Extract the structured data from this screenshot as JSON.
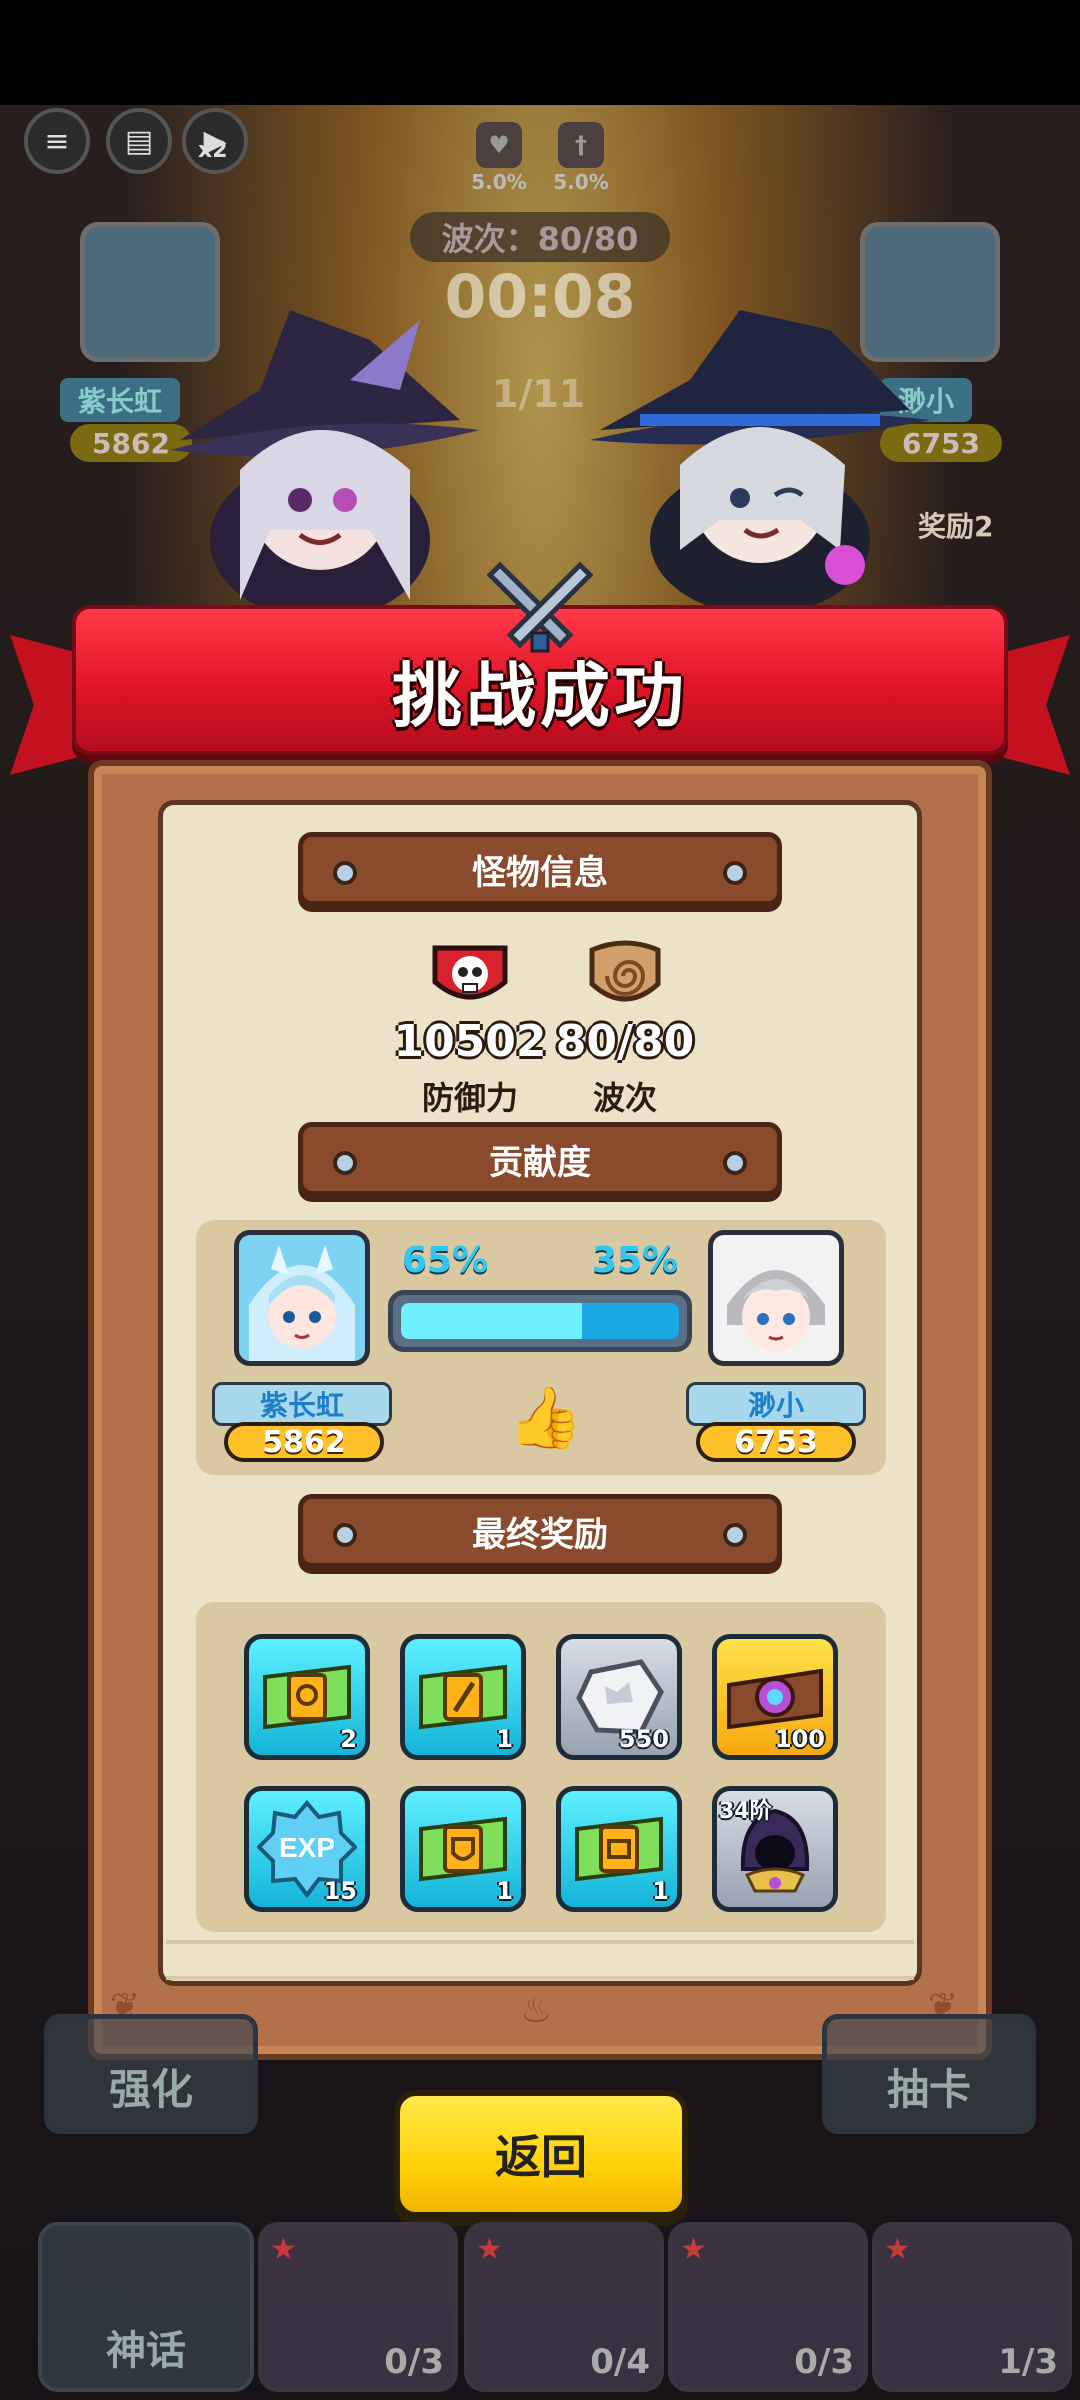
{
  "hud": {
    "speed": "x2",
    "buffs": [
      {
        "icon": "broken-heart-icon",
        "value": "5.0%"
      },
      {
        "icon": "broken-sword-icon",
        "value": "5.0%"
      }
    ],
    "wave_label": "波次：80/80",
    "timer": "00:08",
    "background_round": "1/11",
    "left_player": {
      "name": "紫长虹",
      "score": "5862"
    },
    "right_player": {
      "name": "渺小",
      "score": "6753"
    },
    "reward_hint": "奖励2"
  },
  "banner": {
    "title": "挑战成功"
  },
  "monster_info": {
    "section_title": "怪物信息",
    "defense": {
      "value": "10502",
      "label": "防御力",
      "icon": "skull-shield-icon"
    },
    "waves": {
      "value": "80/80",
      "label": "波次",
      "icon": "spiral-shield-icon"
    }
  },
  "contribution": {
    "section_title": "贡献度",
    "left": {
      "percent": "65%",
      "name": "紫长虹",
      "score": "5862",
      "fraction": 0.65
    },
    "right": {
      "percent": "35%",
      "name": "渺小",
      "score": "6753"
    }
  },
  "rewards": {
    "section_title": "最终奖励",
    "items": [
      {
        "icon": "green-ticket-icon",
        "count": "2",
        "style": "teal"
      },
      {
        "icon": "green-sword-ticket-icon",
        "count": "1",
        "style": "teal"
      },
      {
        "icon": "silver-ore-icon",
        "count": "550",
        "style": "silver"
      },
      {
        "icon": "magic-ticket-icon",
        "count": "100",
        "style": "gold"
      },
      {
        "icon": "exp-badge-icon",
        "count": "15",
        "style": "teal",
        "text": "EXP"
      },
      {
        "icon": "green-shield-ticket-icon",
        "count": "1",
        "style": "teal"
      },
      {
        "icon": "green-chest-ticket-icon",
        "count": "1",
        "style": "teal"
      },
      {
        "icon": "hooded-mage-icon",
        "count": "",
        "style": "silver",
        "tier": "34阶"
      }
    ]
  },
  "bottom": {
    "strengthen": "强化",
    "draw": "抽卡",
    "myth": "神话",
    "return_label": "返回",
    "units": [
      "0/3",
      "0/4",
      "0/3",
      "1/3"
    ]
  }
}
